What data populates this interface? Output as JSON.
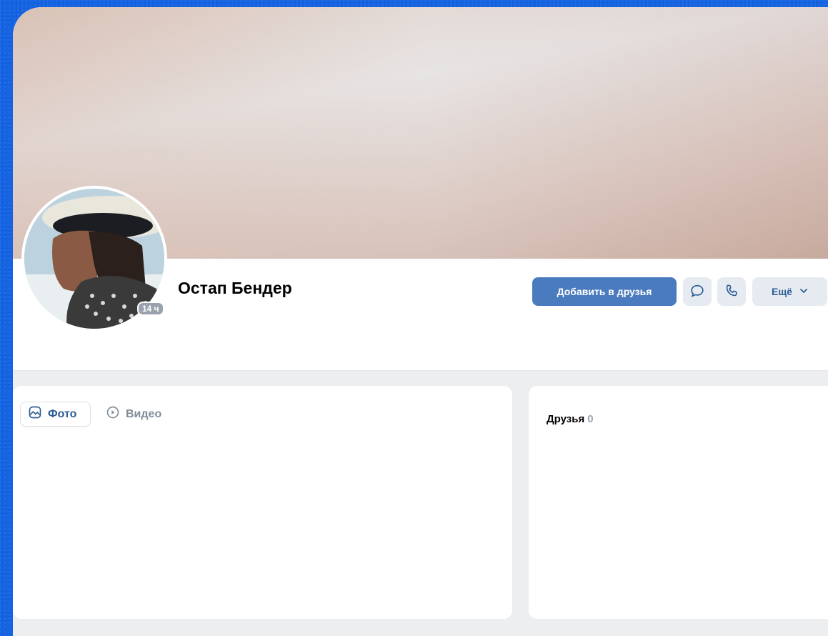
{
  "profile": {
    "name": "Остап Бендер",
    "last_seen_badge": "14 ч"
  },
  "actions": {
    "add_friend": "Добавить в друзья",
    "more": "Ещё"
  },
  "icons": {
    "chat": "chat-bubble-icon",
    "phone": "phone-icon",
    "more_chevron": "chevron-down-icon",
    "photo_tab": "picture-icon",
    "video_tab": "play-circle-icon"
  },
  "media_tabs": [
    {
      "label": "Фото",
      "selected": true
    },
    {
      "label": "Видео",
      "selected": false
    }
  ],
  "friends": {
    "label": "Друзья",
    "count": "0"
  },
  "colors": {
    "background": "#1565e6",
    "primary_button": "#4a7bbf",
    "secondary_button": "#e5ebf1",
    "link_text": "#2c5d94",
    "muted_text": "#818c99"
  }
}
